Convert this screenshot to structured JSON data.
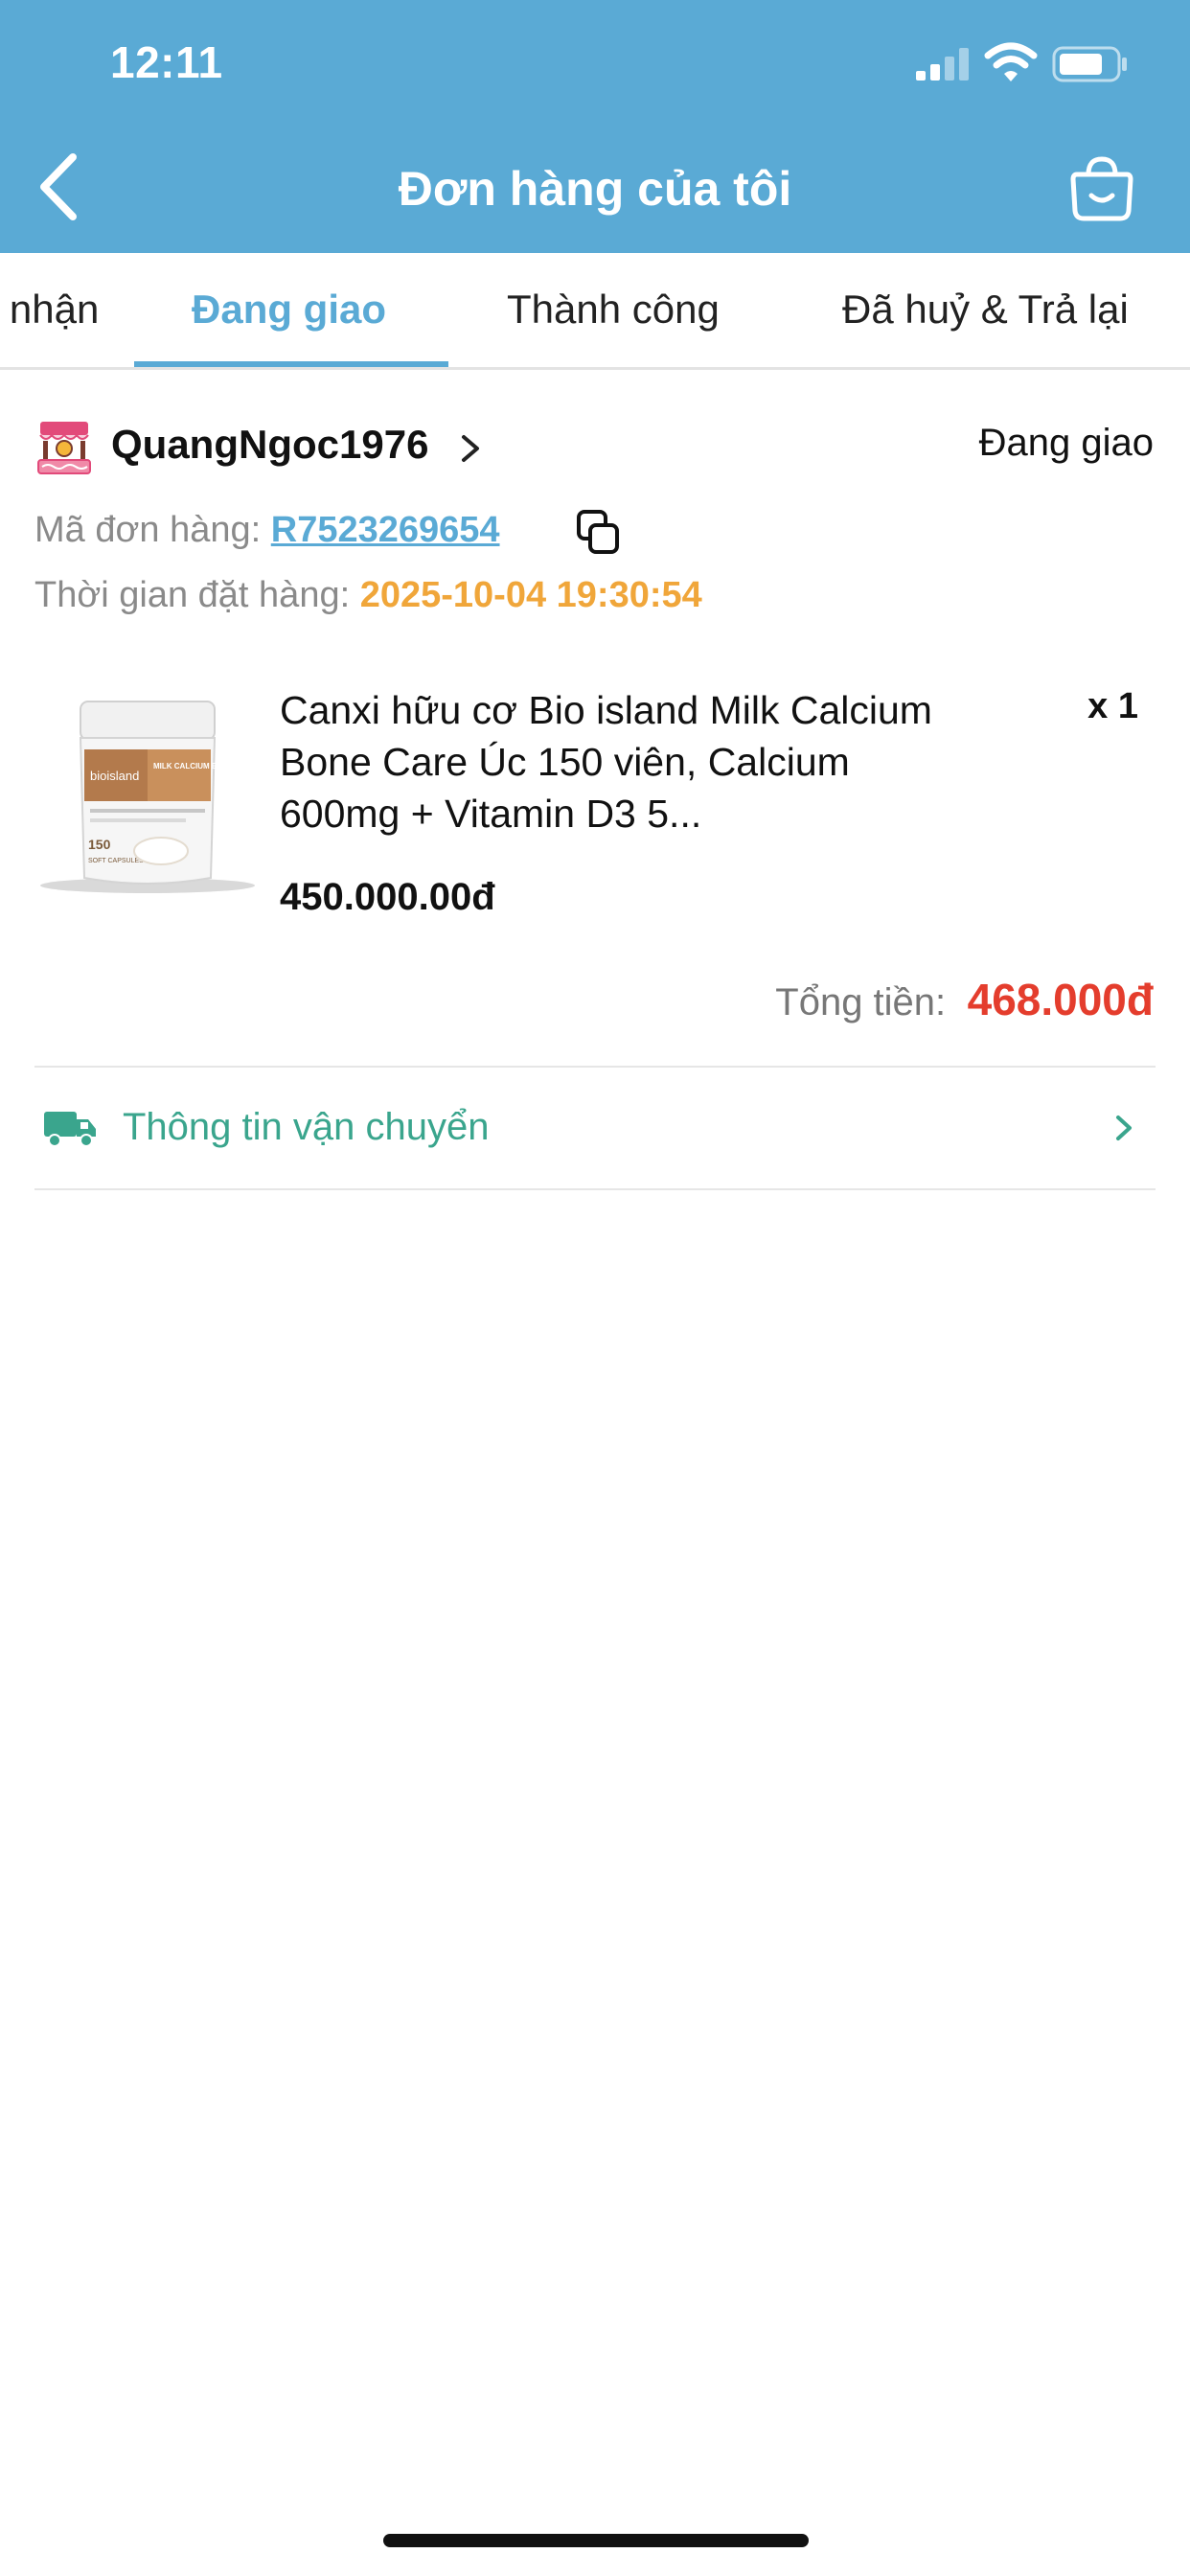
{
  "status_bar": {
    "time": "12:11"
  },
  "header": {
    "title": "Đơn hàng của tôi"
  },
  "tabs": [
    {
      "label": "Chờ xác nhận",
      "active": false
    },
    {
      "label": "Đang giao",
      "active": true
    },
    {
      "label": "Thành công",
      "active": false
    },
    {
      "label": "Đã huỷ & Trả lại",
      "active": false
    }
  ],
  "order": {
    "shop_name": "QuangNgoc1976",
    "status": "Đang giao",
    "id_label": "Mã đơn hàng:",
    "id": "R7523269654",
    "time_label": "Thời gian đặt hàng:",
    "time": "2025-10-04 19:30:54",
    "product": {
      "name": "Canxi hữu cơ Bio island Milk Calcium Bone Care Úc 150 viên, Calcium 600mg + Vitamin D3 5...",
      "qty": "x 1",
      "price": "450.000.00đ",
      "image_text": {
        "brand": "bioisland",
        "title": "MILK CALCIUM BONE CARE",
        "count": "150",
        "unit": "SOFT CAPSULES"
      }
    },
    "total_label": "Tổng tiền:",
    "total": "468.000đ",
    "shipping_label": "Thông tin vận chuyển"
  },
  "colors": {
    "primary": "#5aaad5",
    "order_time": "#f0a63a",
    "total": "#e43d2d",
    "shipping": "#3aa58d"
  }
}
